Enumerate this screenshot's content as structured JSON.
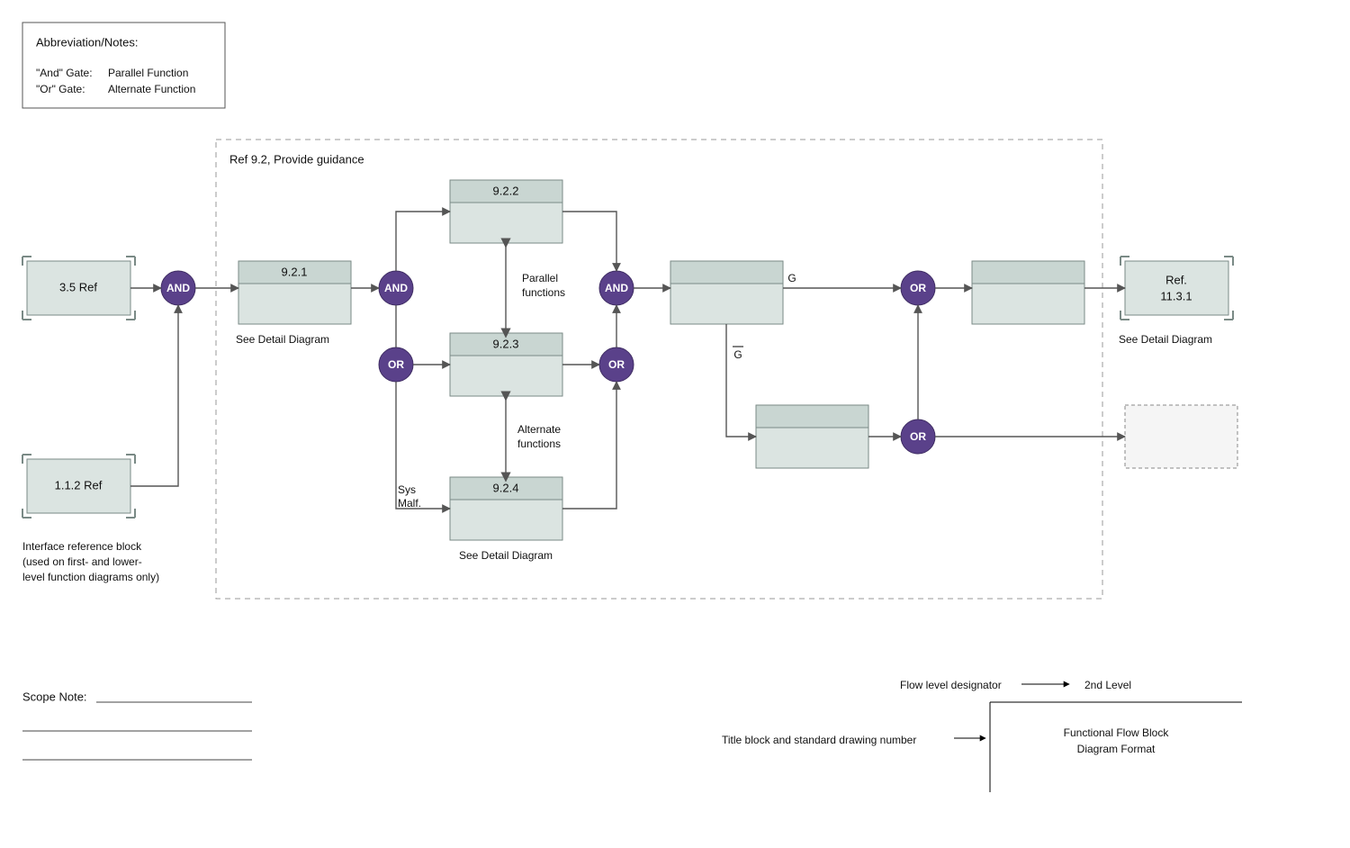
{
  "notes": {
    "title": "Abbreviation/Notes:",
    "and_key": "\"And\" Gate:",
    "and_val": "Parallel Function",
    "or_key": "\"Or\" Gate:",
    "or_val": "Alternate Function"
  },
  "container_title": "Ref 9.2, Provide guidance",
  "refblocks": {
    "a": "3.5 Ref",
    "b": "1.1.2 Ref",
    "caption1": "Interface reference block",
    "caption2": "(used on first- and lower-",
    "caption3": "level function diagrams only)"
  },
  "blocks": {
    "b921": "9.2.1",
    "b921_cap": "See Detail Diagram",
    "b922": "9.2.2",
    "b923": "9.2.3",
    "b924": "9.2.4",
    "b924_cap": "See Detail Diagram",
    "ref1131_a": "Ref.",
    "ref1131_b": "11.3.1",
    "ref1131_cap": "See Detail Diagram"
  },
  "labels": {
    "parallel1": "Parallel",
    "parallel2": "functions",
    "alternate1": "Alternate",
    "alternate2": "functions",
    "sys1": "Sys",
    "sys2": "Malf.",
    "g": "G",
    "gbar": "G"
  },
  "gates": {
    "and": "AND",
    "or": "OR"
  },
  "footer": {
    "scope": "Scope Note:",
    "flow_level": "Flow level designator",
    "second_level": "2nd Level",
    "title_block": "Title block and standard drawing number",
    "format1": "Functional Flow Block",
    "format2": "Diagram Format"
  }
}
